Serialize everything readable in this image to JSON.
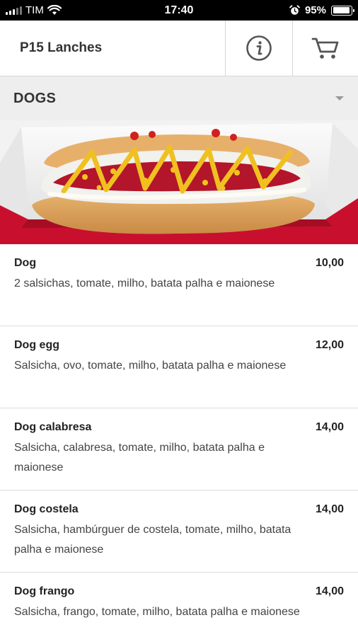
{
  "status_bar": {
    "carrier": "TIM",
    "time": "17:40",
    "battery_percent": "95%",
    "battery_level": 0.95
  },
  "header": {
    "title": "P15 Lanches",
    "icons": [
      "info-icon",
      "cart-icon"
    ]
  },
  "category": {
    "title": "DOGS"
  },
  "colors": {
    "accent_red": "#c8102e",
    "header_border": "#d6d6d6",
    "category_bg": "#eeeeee"
  },
  "menu_items": [
    {
      "name": "Dog",
      "price": "10,00",
      "description": "2 salsichas, tomate, milho, batata palha e maionese"
    },
    {
      "name": "Dog egg",
      "price": "12,00",
      "description": "Salsicha, ovo, tomate, milho, batata palha e maionese"
    },
    {
      "name": "Dog calabresa",
      "price": "14,00",
      "description": "Salsicha, calabresa, tomate, milho, batata palha e maionese"
    },
    {
      "name": "Dog costela",
      "price": "14,00",
      "description": "Salsicha, hambúrguer de costela, tomate, milho, batata palha e maionese"
    },
    {
      "name": "Dog frango",
      "price": "14,00",
      "description": "Salsicha, frango, tomate, milho, batata palha e maionese"
    }
  ]
}
